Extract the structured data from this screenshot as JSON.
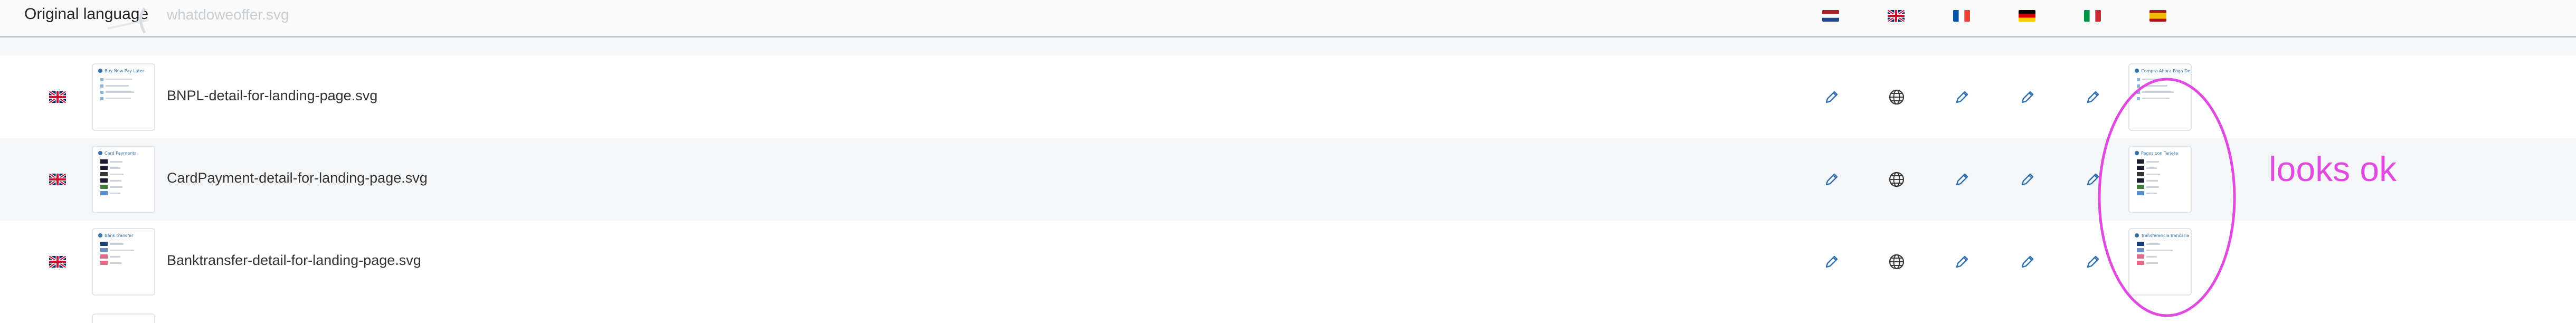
{
  "header": {
    "title": "Original language",
    "filename": "whatdoweoffer.svg",
    "language_flags": [
      "flag-nl",
      "flag-gb",
      "flag-fr",
      "flag-de",
      "flag-it",
      "flag-es"
    ]
  },
  "rows": [
    {
      "flag": "flag-gb",
      "name": "BNPL-detail-for-landing-page.svg",
      "thumb_title": "Buy Now Pay Later",
      "thumb_title_right": "Compra Ahora Paga Despues",
      "actions": [
        "pencil-icon",
        "globe-icon",
        "pencil-icon",
        "pencil-icon",
        "pencil-icon"
      ]
    },
    {
      "flag": "flag-gb",
      "name": "CardPayment-detail-for-landing-page.svg",
      "thumb_title": "Card Payments",
      "thumb_title_right": "Pagos con Tarjeta",
      "actions": [
        "pencil-icon",
        "globe-icon",
        "pencil-icon",
        "pencil-icon",
        "pencil-icon"
      ]
    },
    {
      "flag": "flag-gb",
      "name": "Banktransfer-detail-for-landing-page.svg",
      "thumb_title": "Bank transfer",
      "thumb_title_right": "Transferencia Bancaria",
      "actions": [
        "pencil-icon",
        "globe-icon",
        "pencil-icon",
        "pencil-icon",
        "pencil-icon"
      ]
    }
  ],
  "annotation": {
    "text": "looks ok",
    "color": "#e04ae0"
  },
  "colors": {
    "accent": "#2f6fae",
    "header_border": "#b9c3cc",
    "row_alt": "#f5f6f7"
  }
}
